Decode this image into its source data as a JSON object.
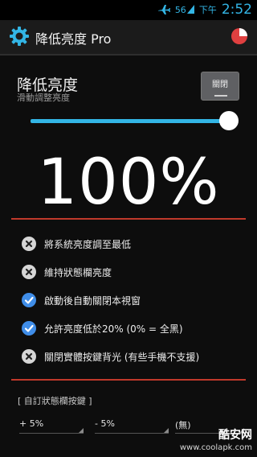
{
  "status_bar": {
    "signal": "56",
    "ampm": "下午",
    "time": "2:52"
  },
  "app": {
    "title": "降低亮度 Pro"
  },
  "brightness": {
    "title": "降低亮度",
    "subtitle": "滑動調整亮度",
    "close_label": "關閉",
    "slider_value": 1.0,
    "percent_text": "100%"
  },
  "options": [
    {
      "label": "將系統亮度調至最低",
      "checked": false
    },
    {
      "label": "維持狀態欄亮度",
      "checked": false
    },
    {
      "label": "啟動後自動關閉本視窗",
      "checked": true
    },
    {
      "label": "允許亮度低於20% (0% = 全黑)",
      "checked": true
    },
    {
      "label": "關閉實體按鍵背光 (有些手機不支援)",
      "checked": false
    }
  ],
  "custom_buttons": {
    "title": "[ 自訂狀態欄按鍵 ]",
    "dropdowns": [
      "+ 5%",
      "- 5%",
      "(無)"
    ]
  },
  "watermark": {
    "title": "酷安网",
    "url": "www.coolapk.com"
  },
  "colors": {
    "accent": "#33b5e5",
    "divider": "#c0392b",
    "check": "#3f8de8"
  }
}
